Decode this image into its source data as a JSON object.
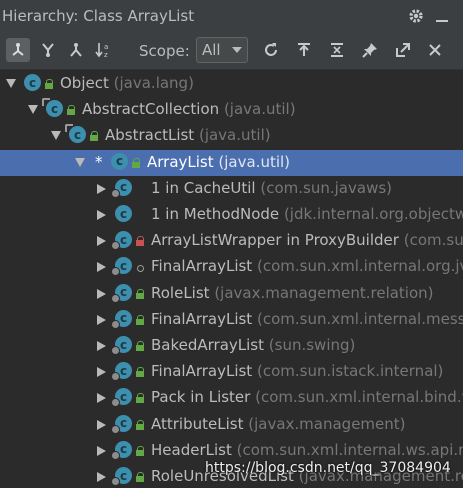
{
  "header": {
    "title": "Hierarchy:  Class ArrayList",
    "settings_icon": "gear-icon",
    "minimize_icon": "minimize-icon"
  },
  "toolbar": {
    "scope_label": "Scope:",
    "scope_value": "All",
    "buttons": [
      {
        "name": "type-hierarchy-icon",
        "active": true
      },
      {
        "name": "supertypes-hierarchy-icon"
      },
      {
        "name": "subtypes-hierarchy-icon"
      },
      {
        "name": "sort-alphabetically-icon"
      },
      {
        "name": "refresh-icon"
      },
      {
        "name": "expand-all-icon"
      },
      {
        "name": "collapse-all-icon"
      },
      {
        "name": "pin-icon"
      },
      {
        "name": "open-external-icon"
      },
      {
        "name": "close-icon"
      }
    ]
  },
  "tree": {
    "rows": [
      {
        "toggle": "down",
        "star": false,
        "name": "Object",
        "pkg": "(java.lang)",
        "vis": "pub",
        "abstract": false,
        "badge": false
      },
      {
        "toggle": "down",
        "star": false,
        "name": "AbstractCollection",
        "pkg": "(java.util)",
        "vis": "pub",
        "abstract": true,
        "badge": false
      },
      {
        "toggle": "down",
        "star": false,
        "name": "AbstractList",
        "pkg": "(java.util)",
        "vis": "pub",
        "abstract": true,
        "badge": false
      },
      {
        "toggle": "down",
        "star": true,
        "name": "ArrayList",
        "pkg": "(java.util)",
        "vis": "pub",
        "abstract": false,
        "badge": false,
        "selected": true
      },
      {
        "toggle": "right",
        "star": false,
        "name": "1 in CacheUtil",
        "pkg": "(com.sun.javaws)",
        "vis": "none",
        "abstract": false,
        "badge": true
      },
      {
        "toggle": "right",
        "star": false,
        "name": "1 in MethodNode",
        "pkg": "(jdk.internal.org.objectw",
        "vis": "none",
        "abstract": false,
        "badge": false
      },
      {
        "toggle": "right",
        "star": false,
        "name": "ArrayListWrapper in ProxyBuilder",
        "pkg": "(com.su",
        "vis": "priv",
        "abstract": false,
        "badge": true
      },
      {
        "toggle": "right",
        "star": false,
        "name": "FinalArrayList",
        "pkg": "(com.sun.xml.internal.org.jvn",
        "vis": "pkg",
        "abstract": false,
        "badge": true
      },
      {
        "toggle": "right",
        "star": false,
        "name": "RoleList",
        "pkg": "(javax.management.relation)",
        "vis": "pub",
        "abstract": false,
        "badge": true
      },
      {
        "toggle": "right",
        "star": false,
        "name": "FinalArrayList",
        "pkg": "(com.sun.xml.internal.messa",
        "vis": "pub",
        "abstract": false,
        "badge": true
      },
      {
        "toggle": "right",
        "star": false,
        "name": "BakedArrayList",
        "pkg": "(sun.swing)",
        "vis": "pub",
        "abstract": false,
        "badge": true
      },
      {
        "toggle": "right",
        "star": false,
        "name": "FinalArrayList",
        "pkg": "(com.sun.istack.internal)",
        "vis": "pub",
        "abstract": false,
        "badge": true
      },
      {
        "toggle": "right",
        "star": false,
        "name": "Pack in Lister",
        "pkg": "(com.sun.xml.internal.bind.v.",
        "vis": "pub",
        "abstract": false,
        "badge": true
      },
      {
        "toggle": "right",
        "star": false,
        "name": "AttributeList",
        "pkg": "(javax.management)",
        "vis": "pub",
        "abstract": false,
        "badge": true
      },
      {
        "toggle": "right",
        "star": false,
        "name": "HeaderList",
        "pkg": "(com.sun.xml.internal.ws.api.m",
        "vis": "pub",
        "abstract": false,
        "badge": true
      },
      {
        "toggle": "right",
        "star": false,
        "name": "RoleUnresolvedList",
        "pkg": "(javax.management.rela",
        "vis": "pub",
        "abstract": false,
        "badge": true
      }
    ]
  },
  "watermark": "https://blog.csdn.net/qq_37084904"
}
